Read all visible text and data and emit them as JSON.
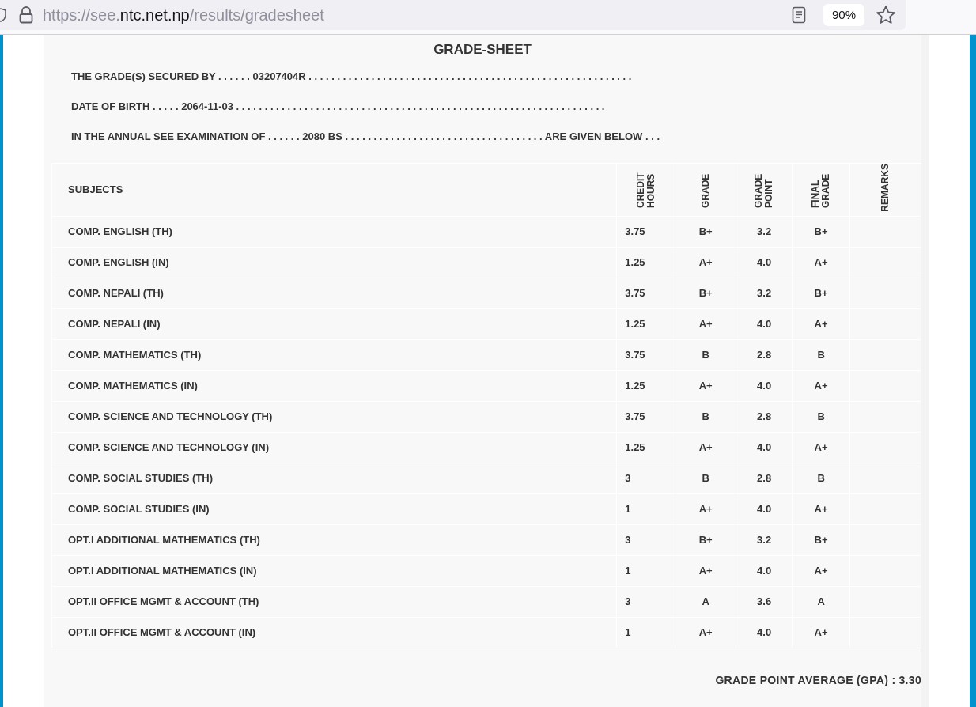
{
  "browser": {
    "url_prefix": "https://see.",
    "url_domain": "ntc.net.np",
    "url_path": "/results/gradesheet",
    "zoom": "90%"
  },
  "title": "GRADE-SHEET",
  "info_lines": [
    {
      "text": "THE GRADE(S) SECURED BY . . . . . . 03207404R . . . . . . . . . . . . . . . . . . . . . . . . . . . . . . . . . . . . . . . . . . . . . . . . . . . . . . . . ."
    },
    {
      "text": "DATE OF BIRTH . . . . . 2064-11-03 . . . . . . . . . . . . . . . . . . . . . . . . . . . . . . . . . . . . . . . . . . . . . . . . . . . . . . . . . . . . . . . . ."
    },
    {
      "text": "IN THE ANNUAL SEE EXAMINATION OF . . . . . . 2080 BS . . . . . . . . . . . . . . . . . . . . . . . . . . . . . . . . . . . ARE GIVEN BELOW . . ."
    }
  ],
  "table": {
    "columns": [
      "SUBJECTS",
      "CREDIT HOURS",
      "GRADE",
      "GRADE POINT",
      "FINAL GRADE",
      "REMARKS"
    ],
    "rows": [
      [
        "COMP. ENGLISH (TH)",
        "3.75",
        "B+",
        "3.2",
        "B+"
      ],
      [
        "COMP. ENGLISH (IN)",
        "1.25",
        "A+",
        "4.0",
        "A+"
      ],
      [
        "COMP. NEPALI (TH)",
        "3.75",
        "B+",
        "3.2",
        "B+"
      ],
      [
        "COMP. NEPALI (IN)",
        "1.25",
        "A+",
        "4.0",
        "A+"
      ],
      [
        "COMP. MATHEMATICS (TH)",
        "3.75",
        "B",
        "2.8",
        "B"
      ],
      [
        "COMP. MATHEMATICS (IN)",
        "1.25",
        "A+",
        "4.0",
        "A+"
      ],
      [
        "COMP. SCIENCE AND TECHNOLOGY (TH)",
        "3.75",
        "B",
        "2.8",
        "B"
      ],
      [
        "COMP. SCIENCE AND TECHNOLOGY (IN)",
        "1.25",
        "A+",
        "4.0",
        "A+"
      ],
      [
        "COMP. SOCIAL STUDIES (TH)",
        "3",
        "B",
        "2.8",
        "B"
      ],
      [
        "COMP. SOCIAL STUDIES (IN)",
        "1",
        "A+",
        "4.0",
        "A+"
      ],
      [
        "OPT.I ADDITIONAL MATHEMATICS (TH)",
        "3",
        "B+",
        "3.2",
        "B+"
      ],
      [
        "OPT.I ADDITIONAL MATHEMATICS (IN)",
        "1",
        "A+",
        "4.0",
        "A+"
      ],
      [
        "OPT.II OFFICE MGMT & ACCOUNT (TH)",
        "3",
        "A",
        "3.6",
        "A"
      ],
      [
        "OPT.II OFFICE MGMT & ACCOUNT (IN)",
        "1",
        "A+",
        "4.0",
        "A+"
      ]
    ]
  },
  "gpa": "GRADE POINT AVERAGE (GPA) : 3.30"
}
